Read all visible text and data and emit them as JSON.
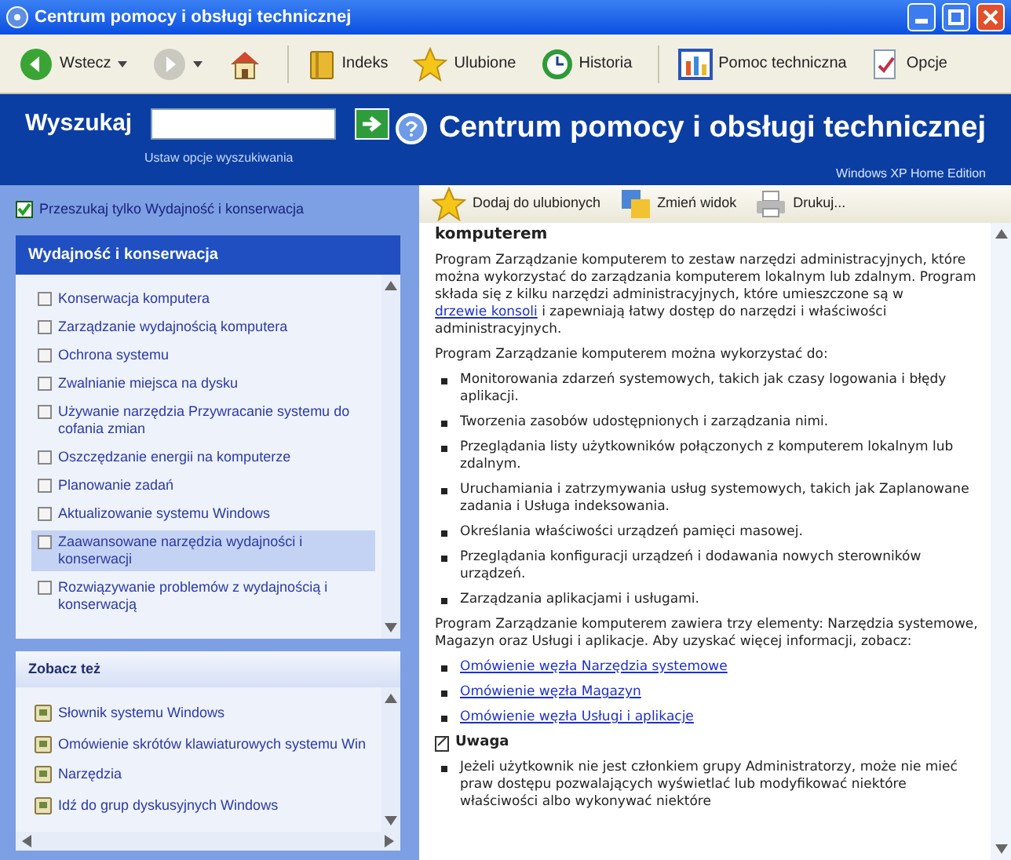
{
  "window": {
    "title": "Centrum pomocy i obsługi technicznej"
  },
  "toolbar": [
    {
      "kind": "back",
      "label": "Wstecz"
    },
    {
      "kind": "forward"
    },
    {
      "kind": "home"
    },
    {
      "kind": "index",
      "label": "Indeks"
    },
    {
      "kind": "favorites",
      "label": "Ulubione"
    },
    {
      "kind": "history",
      "label": "Historia"
    },
    {
      "kind": "support",
      "label": "Pomoc techniczna"
    },
    {
      "kind": "options",
      "label": "Opcje"
    }
  ],
  "search": {
    "label": "Wyszukaj",
    "options_link": "Ustaw opcje wyszukiwania"
  },
  "banner": {
    "title": "Centrum pomocy i obsługi technicznej",
    "edition": "Windows XP Home Edition"
  },
  "search_scope": {
    "label": "Przeszukaj tylko Wydajność i konserwacja",
    "checked": true
  },
  "topics": {
    "title": "Wydajność i konserwacja",
    "items": [
      {
        "label": "Konserwacja komputera",
        "selected": false
      },
      {
        "label": "Zarządzanie wydajnością komputera",
        "selected": false
      },
      {
        "label": "Ochrona systemu",
        "selected": false
      },
      {
        "label": "Zwalnianie miejsca na dysku",
        "selected": false
      },
      {
        "label": "Używanie narzędzia Przywracanie systemu do cofania zmian",
        "selected": false
      },
      {
        "label": "Oszczędzanie energii na komputerze",
        "selected": false
      },
      {
        "label": "Planowanie zadań",
        "selected": false
      },
      {
        "label": "Aktualizowanie systemu Windows",
        "selected": false
      },
      {
        "label": "Zaawansowane narzędzia wydajności i konserwacji",
        "selected": true
      },
      {
        "label": "Rozwiązywanie problemów z wydajnością i konserwacją",
        "selected": false
      }
    ]
  },
  "see_also": {
    "title": "Zobacz też",
    "items": [
      "Słownik systemu Windows",
      "Omówienie skrótów klawiaturowych systemu Win",
      "Narzędzia",
      "Idź do grup dyskusyjnych Windows"
    ]
  },
  "content_toolbar": [
    {
      "kind": "favorites",
      "label": "Dodaj do ulubionych"
    },
    {
      "kind": "view",
      "label": "Zmień widok"
    },
    {
      "kind": "print",
      "label": "Drukuj..."
    }
  ],
  "content": [
    {
      "kind": "heading",
      "parts": [
        {
          "text": "komputerem"
        }
      ]
    },
    {
      "kind": "paragraph",
      "parts": [
        {
          "text": "Program Zarządzanie komputerem to zestaw narzędzi administracyjnych, które można wykorzystać do zarządzania komputerem lokalnym lub zdalnym. Program składa się z kilku narzędzi administracyjnych, które umieszczone są w "
        },
        {
          "text": "drzewie konsoli",
          "link": true
        },
        {
          "text": " i zapewniają łatwy dostęp do narzędzi i właściwości administracyjnych."
        }
      ]
    },
    {
      "kind": "paragraph",
      "parts": [
        {
          "text": "Program Zarządzanie komputerem można wykorzystać do:"
        }
      ]
    },
    {
      "kind": "bullet",
      "parts": [
        {
          "text": "Monitorowania zdarzeń systemowych, takich jak czasy logowania i błędy aplikacji."
        }
      ]
    },
    {
      "kind": "bullet",
      "parts": [
        {
          "text": "Tworzenia zasobów udostępnionych i zarządzania nimi."
        }
      ]
    },
    {
      "kind": "bullet",
      "parts": [
        {
          "text": "Przeglądania listy użytkowników połączonych z komputerem lokalnym lub zdalnym."
        }
      ]
    },
    {
      "kind": "bullet",
      "parts": [
        {
          "text": "Uruchamiania i zatrzymywania usług systemowych, takich jak Zaplanowane zadania i Usługa indeksowania."
        }
      ]
    },
    {
      "kind": "bullet",
      "parts": [
        {
          "text": "Określania właściwości urządzeń pamięci masowej."
        }
      ]
    },
    {
      "kind": "bullet",
      "parts": [
        {
          "text": "Przeglądania konfiguracji urządzeń i dodawania nowych sterowników urządzeń."
        }
      ]
    },
    {
      "kind": "bullet",
      "parts": [
        {
          "text": "Zarządzania aplikacjami i usługami."
        }
      ]
    },
    {
      "kind": "paragraph",
      "parts": [
        {
          "text": "Program Zarządzanie komputerem zawiera trzy elementy: Narzędzia systemowe, Magazyn oraz Usługi i aplikacje. Aby uzyskać więcej informacji, zobacz:"
        }
      ]
    },
    {
      "kind": "bullet",
      "parts": [
        {
          "text": "Omówienie węzła Narzędzia systemowe",
          "link": true
        }
      ]
    },
    {
      "kind": "bullet",
      "parts": [
        {
          "text": "Omówienie węzła Magazyn",
          "link": true
        }
      ]
    },
    {
      "kind": "bullet",
      "parts": [
        {
          "text": "Omówienie węzła Usługi i aplikacje",
          "link": true
        }
      ]
    },
    {
      "kind": "note",
      "parts": [
        {
          "text": "Uwaga"
        }
      ]
    },
    {
      "kind": "bullet",
      "parts": [
        {
          "text": "Jeżeli użytkownik nie jest członkiem grupy Administratorzy, może nie mieć praw dostępu pozwalających wyświetlać lub modyfikować niektóre właściwości albo wykonywać niektóre"
        }
      ]
    }
  ]
}
